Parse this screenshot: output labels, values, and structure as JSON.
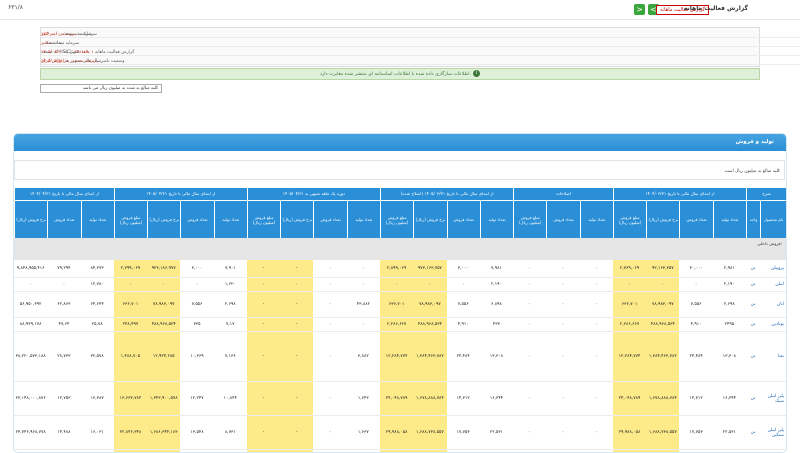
{
  "topbar": {
    "logo": "۶۳۱/۸",
    "title": "گزارش فعالیت ماهانه",
    "badge": "گزارش فعالیت ماهانه",
    "prev": "<",
    "next": ">"
  },
  "info": {
    "company_label": "شرکت:",
    "company": "پتروشیمی امیر کبیر",
    "symbol_label": "نماد:",
    "symbol": "شکبیر",
    "code_label": "کد صنعت (ISIC):",
    "code": "۲۴۱۱۰۸",
    "period_label": "سال مالی منتهی به:",
    "period": "۱۴۰۵/۰۳/۳۱",
    "capital_label": "سرمایه ثبت شده:",
    "capital": "۱۷,۴۰۰,۰۰۰",
    "unreg_label": "سرمایه ثبت نشده:",
    "unreg": "۰",
    "report_label": "گزارش فعالیت ماهانه",
    "report_period": "۱ ماهه",
    "report_end_label": "منتهی به",
    "report_end": "۱۴۰۵/۰۸/۳۰",
    "status_label": "وضعیت ناشر:",
    "status": "پذیرفته شده در فرابورس ایران"
  },
  "message": "اطلاعات سازگاری داده شده با اطلاعات اساسنامه ای منتشر شده مغایرت دارد.",
  "select_value": "کلیه مبالغ به شده به میلیون ریال می باشد",
  "panel": {
    "title": "تولید و فروش",
    "note": "کلیه مبالغ به میلیون ریال است"
  },
  "groups": [
    "شرح",
    "از ابتدای سال مالی تا تاریخ ۱۴۰۴/۰۳/۳۱",
    "اصلاحات",
    "از ابتدای سال مالی تا تاریخ ۱۴۰۵/۰۳/۳۱ (اصلاح شده)",
    "دوره یک ماهه منتهی به ۱۴۰۵/۰۴/۳۱",
    "از ابتدای سال مالی تا تاریخ ۱۴۰۵/۰۴/۳۱",
    "از ابتدای سال مالی تا تاریخ ۱۴۰۴/۰۴/۳۱"
  ],
  "columns": [
    "نام محصول",
    "واحد",
    "تعداد تولید",
    "تعداد فروش",
    "نرخ فروش (ریال)",
    "مبلغ فروش (میلیون ریال)",
    "تعداد تولید",
    "تعداد فروش",
    "مبلغ فروش (میلیون ریال)",
    "تعداد تولید",
    "تعداد فروش",
    "نرخ فروش (ریال)",
    "مبلغ فروش (میلیون ریال)",
    "تعداد تولید",
    "تعداد فروش",
    "نرخ فروش (ریال)",
    "مبلغ فروش (میلیون ریال)",
    "تعداد تولید",
    "تعداد فروش",
    "نرخ فروش (ریال)",
    "مبلغ فروش (میلیون ریال)",
    "تعداد تولید",
    "تعداد فروش",
    "نرخ فروش (ریال)"
  ],
  "band_label": "فروش داخلی:",
  "rows": [
    [
      "پروپیلن",
      "تن",
      "۲,۹۸۱",
      "۳۰,۰۰۰",
      "۹۲,۱۶۳,۳۵۷",
      "۲,۷۶۹,۰۶۹",
      "۰",
      "۰",
      "۰",
      "۷,۹۸۱",
      "۳,۰۰۰",
      "۹۷۳,۱۶۳,۷۵۷",
      "۲,۸۹۹,۰۶۹",
      "۰",
      "۰",
      "-",
      "-",
      "۷,۹۰۱",
      "۳,۰۰۰",
      "۹۲۳,۱۸۶,۹۷۷",
      "۲,۷۹۹,۰۶۹",
      "۸۴,۲۷۳",
      "۷۹,۲۹۴",
      "۹,۸۴۸,۹۵۵,۴۱۶"
    ],
    [
      "اتیلن",
      "تن",
      "۲,۱۹۰",
      "۰",
      "۰",
      "۰",
      "۰",
      "۰",
      "۰",
      "۲,۱۹۰",
      "۰",
      "۰",
      "۰",
      "۰",
      "۰",
      "۰",
      "۰",
      "۱,۶۲۰",
      "۰",
      "۰",
      "۰",
      "۱۲,۷۸۰",
      "۰",
      "۰"
    ],
    [
      "اتان",
      "تن",
      "۲,۶۹۸",
      "۷,۵۵۶",
      "۷۸,۹۸۳,۰۹۷",
      "۶۳۶,۷۰۱",
      "۰",
      "۰",
      "۰",
      "۶,۸۹۸",
      "۷,۵۵۶",
      "۷۸,۹۸۳,۰۹۷",
      "۶۳۶,۷۰۱",
      "۴۳,۸۸۲",
      "۰",
      "-",
      "-",
      "۲,۶۹۸",
      "۷,۵۵۶",
      "۷۸,۹۸۳,۰۹۷",
      "۶۳۶,۷۰۱",
      "۶۴,۶۴۴",
      "۶۲,۸۶۳",
      "۵۶,۹۵۰,۳۹۲"
    ],
    [
      "بوتادین",
      "تن",
      "۲۴۹۵",
      "۴,۹۱۰",
      "۴۸۸,۹۶۸,۵۳۴",
      "۲,۲۸۶,۶۶۷",
      "۰",
      "۰",
      "۰",
      "۴۳۷",
      "۴,۹۱۰",
      "۴۸۸,۹۶۸,۵۳۴",
      "۲,۲۸۶,۶۶۷",
      "۰",
      "۰",
      "-",
      "-",
      "۷,۱۷",
      "۳۳۵",
      "۴۸۸,۹۶۸,۵۳۴",
      "۲۴۸,۴۹۷",
      "۲۵,۷۸",
      "۴۷,۶۴",
      "۸۸,۹۳۹,۱۷۸"
    ],
    [
      "نفتا",
      "تن",
      "۱۳,۳۰۸",
      "۲۴,۴۸۴",
      "۱,۳۸۴,۴۶۳,۷۸۲",
      "۱۲,۲۸۴,۷۷۴",
      "۰",
      "۰",
      "۰",
      "۱۳,۳۰۸",
      "۲۴,۴۸۴",
      "۱,۳۸۴,۴۶۳,۷۸۲",
      "۱۲,۲۸۴,۷۷۴",
      "۳,۸۸۲",
      "۰",
      "-",
      "-",
      "۷,۱۳۶",
      "۱۰,۳۶۹",
      "۱۲,۹۲۴,۲۸۵",
      "۱,۴۸۸,۷۰۵",
      "۳۲,۵۷۸",
      "۲۸,۷۳۳",
      "۳۸,۲۲۰,۵۷۳,۱۸۸"
    ],
    [
      "پلی اتیلن سبک",
      "تن",
      "۱۶,۳۴۴",
      "۱۴,۳۱۲",
      "۱,۶۷۸,۸۸۸,۷۸۴",
      "۲۴,۰۴۸,۷۸۹",
      "۰",
      "۰",
      "۰",
      "۱۶,۳۴۴",
      "۱۴,۳۱۲",
      "۱,۶۷۸,۸۸۸,۷۸۴",
      "۲۴,۰۴۸,۷۸۹",
      "۱,۶۴۳",
      "۰",
      "-",
      "-",
      "۱۰,۸۴۴",
      "۱۲,۲۴۷",
      "۱,۳۴۳,۹۰۰,۵۷۸",
      "۱۳,۶۳۳,۷۸۴",
      "۱۳,۳۸۷",
      "۱۲,۷۵۳",
      "۲۳,۱۴۸,۰۰۰,۸۷۶"
    ],
    [
      "پلی اتیلن سنگین",
      "تن",
      "۲۲,۵۳۱",
      "۱۷,۷۵۳",
      "۱,۶۸۸,۷۳۸,۵۵۷",
      "۲۹,۹۸۸,۰۵۸",
      "۰",
      "۰",
      "۰",
      "۲۲,۵۳۱",
      "۱۷,۷۵۳",
      "۱,۶۸۸,۷۳۸,۵۵۷",
      "۲۹,۹۸۸,۰۵۸",
      "۱,۶۳۷",
      "۰",
      "-",
      "-",
      "۸,۷۳۱",
      "۱۳,۵۴۸",
      "۱,۶۸۶,۳۴۴,۱۸۳",
      "۲۲,۸۴۶,۳۴۸",
      "۱۶,۰۳۱",
      "۱۴,۴۸۸",
      "۲۴,۷۴۶,۹۶۸,۷۷۸"
    ],
    [
      "پلی بوتن",
      "تن",
      "۱۰",
      "۰",
      "۰",
      "۰",
      "۰",
      "۰",
      "۰",
      "۱۰",
      "۰",
      "۰",
      "۰",
      "۰",
      "۰",
      "۰",
      "۰",
      "۱۰",
      "۰",
      "۰",
      "۰",
      "۲۸",
      "۰",
      "۰"
    ]
  ]
}
